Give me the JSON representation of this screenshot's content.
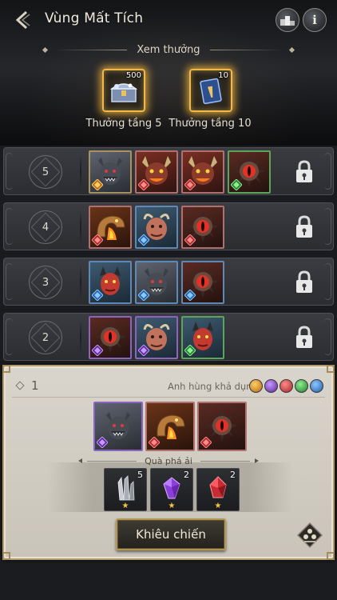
{
  "header": {
    "title": "Vùng Mất Tích",
    "info_label": "i"
  },
  "rewards": {
    "title": "Xem thưởng",
    "chests": [
      {
        "count": "500",
        "label": "Thưởng tầng 5"
      },
      {
        "count": "10",
        "label": "Thưởng tầng 10"
      }
    ]
  },
  "floors": [
    {
      "number": "5",
      "heroes": [
        "werewolf",
        "demon-lord",
        "demon-lord",
        "eye-beast"
      ]
    },
    {
      "number": "4",
      "heroes": [
        "fire-serpent",
        "horned-ogre",
        "eye-beast"
      ]
    },
    {
      "number": "3",
      "heroes": [
        "red-imp",
        "werewolf",
        "eye-beast"
      ]
    },
    {
      "number": "2",
      "heroes": [
        "eye-beast",
        "horned-ogre",
        "red-imp"
      ]
    }
  ],
  "selected_floor": {
    "number": "1",
    "available_heroes_label": "Anh hùng khả dụng",
    "heroes": [
      "werewolf",
      "fire-serpent",
      "eye-beast"
    ],
    "gift_title": "Quà phá ải",
    "items": [
      {
        "name": "crystal-shard",
        "qty": "5",
        "stars": "★"
      },
      {
        "name": "purple-gem",
        "qty": "2",
        "stars": "★"
      },
      {
        "name": "red-gem",
        "qty": "2",
        "stars": "★"
      }
    ],
    "challenge_label": "Khiêu chiến"
  },
  "colors": {
    "gold_border": "#f2b94a",
    "element_orange": "#d9851e",
    "element_purple": "#7a3fbf",
    "element_red": "#c83a3a",
    "element_green": "#3aa64a",
    "element_blue": "#2f7fd1"
  }
}
